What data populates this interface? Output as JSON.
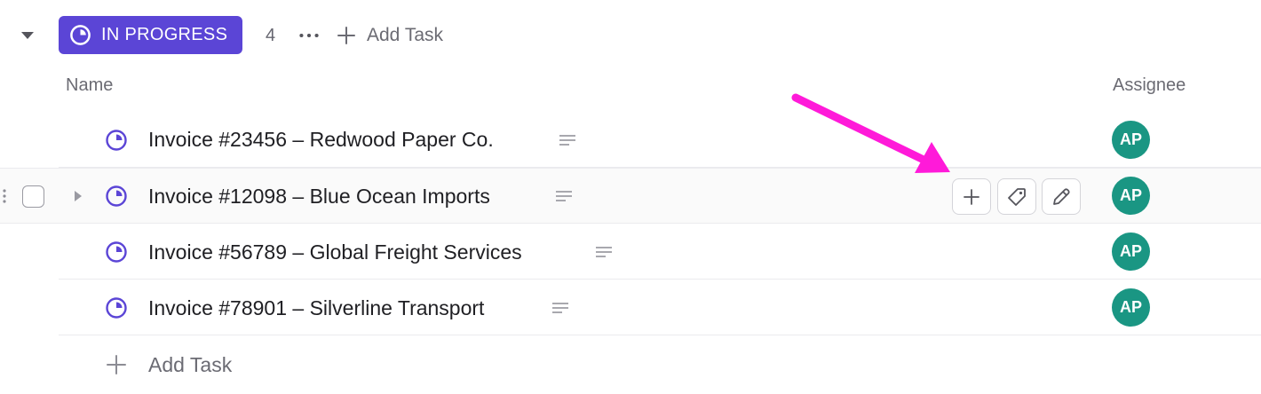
{
  "group": {
    "status_label": "IN PROGRESS",
    "status_color": "#5b45d6",
    "task_count": "4",
    "more_icon": "ellipsis-icon",
    "add_task_label": "Add Task"
  },
  "columns": {
    "name": "Name",
    "assignee": "Assignee"
  },
  "tasks": [
    {
      "title": "Invoice #23456 – Redwood Paper Co.",
      "assignee_initials": "AP"
    },
    {
      "title": "Invoice #12098 – Blue Ocean Imports",
      "assignee_initials": "AP"
    },
    {
      "title": "Invoice #56789 – Global Freight Services",
      "assignee_initials": "AP"
    },
    {
      "title": "Invoice #78901 – Silverline Transport",
      "assignee_initials": "AP"
    }
  ],
  "row_actions": [
    "add-subtask-icon",
    "tag-icon",
    "edit-pencil-icon"
  ],
  "footer": {
    "add_task_label": "Add Task"
  },
  "colors": {
    "avatar": "#1a9683",
    "status_icon": "#5b45d6",
    "annotation_arrow": "#ff1ad9"
  }
}
